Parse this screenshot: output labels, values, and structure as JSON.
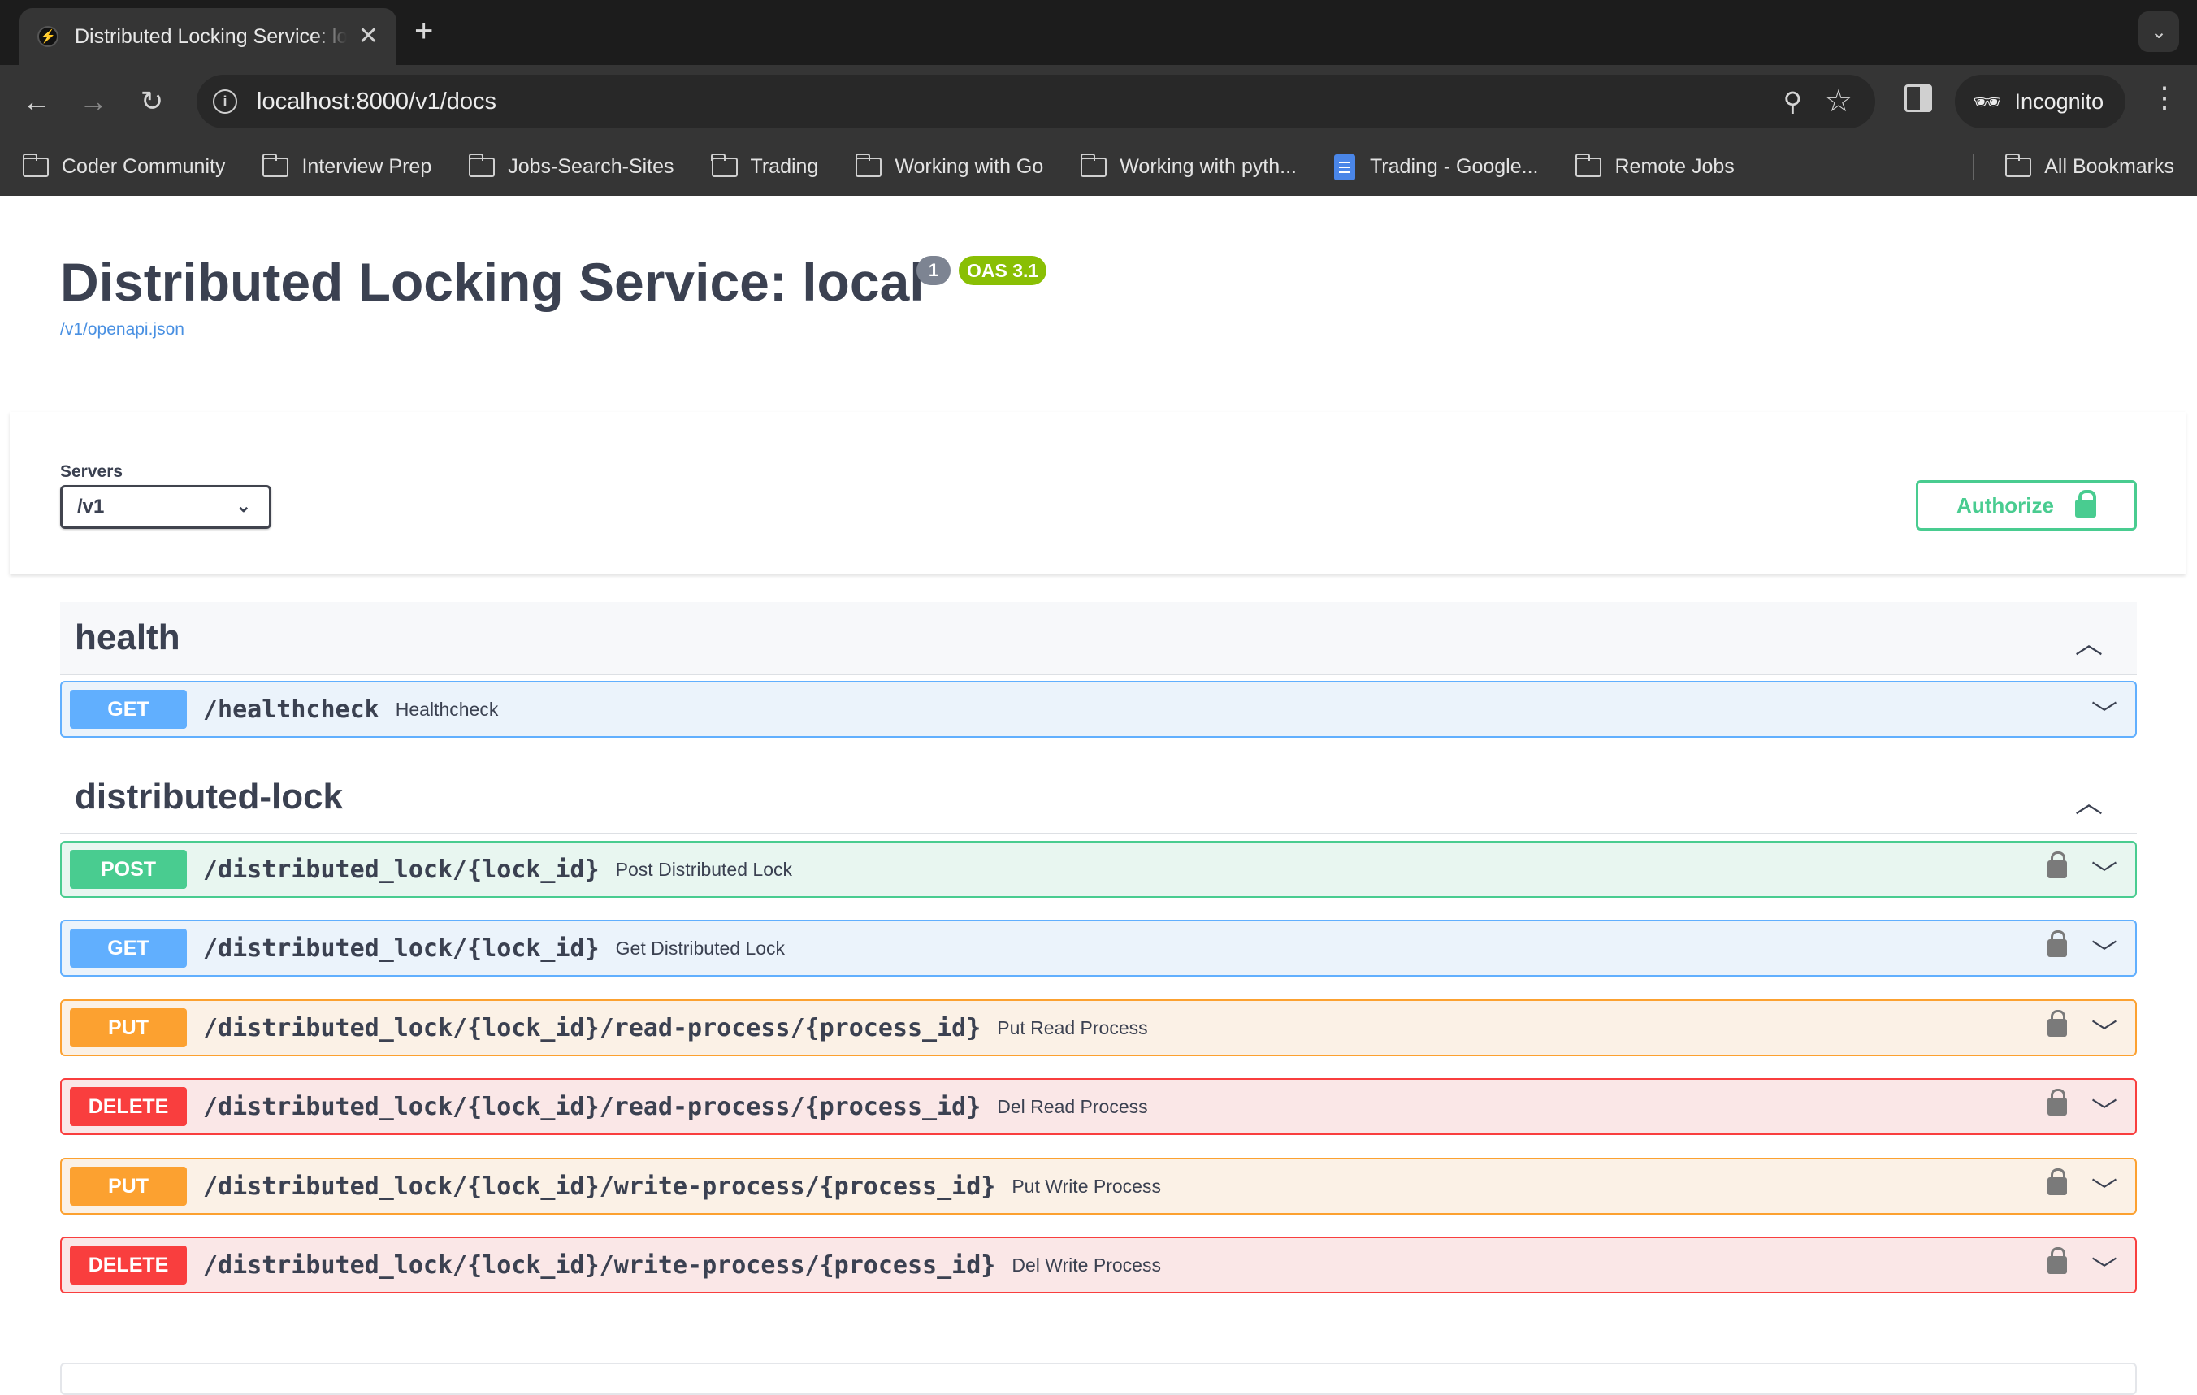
{
  "browser": {
    "tab_title": "Distributed Locking Service: local",
    "url": "localhost:8000/v1/docs",
    "profile_label": "Incognito",
    "bookmarks": [
      {
        "label": "Coder Community",
        "icon": "folder-icon"
      },
      {
        "label": "Interview Prep",
        "icon": "folder-icon"
      },
      {
        "label": "Jobs-Search-Sites",
        "icon": "folder-icon"
      },
      {
        "label": "Trading",
        "icon": "folder-icon"
      },
      {
        "label": "Working with Go",
        "icon": "folder-icon"
      },
      {
        "label": "Working with pyth...",
        "icon": "folder-icon"
      },
      {
        "label": "Trading - Google...",
        "icon": "google-docs-icon"
      },
      {
        "label": "Remote Jobs",
        "icon": "folder-icon"
      }
    ],
    "all_bookmarks_label": "All Bookmarks"
  },
  "info": {
    "title": "Distributed Locking Service: local",
    "version_badge": "1",
    "oas_badge": "OAS 3.1",
    "spec_link": "/v1/openapi.json"
  },
  "servers": {
    "label": "Servers",
    "selected": "/v1"
  },
  "authorize": {
    "label": "Authorize"
  },
  "tags": [
    {
      "name": "health",
      "operations": [
        {
          "method": "GET",
          "path": "/healthcheck",
          "summary": "Healthcheck",
          "locked": false
        }
      ]
    },
    {
      "name": "distributed-lock",
      "operations": [
        {
          "method": "POST",
          "path": "/distributed_lock/{lock_id}",
          "summary": "Post Distributed Lock",
          "locked": true
        },
        {
          "method": "GET",
          "path": "/distributed_lock/{lock_id}",
          "summary": "Get Distributed Lock",
          "locked": true
        },
        {
          "method": "PUT",
          "path": "/distributed_lock/{lock_id}/read-process/{process_id}",
          "summary": "Put Read Process",
          "locked": true
        },
        {
          "method": "DELETE",
          "path": "/distributed_lock/{lock_id}/read-process/{process_id}",
          "summary": "Del Read Process",
          "locked": true
        },
        {
          "method": "PUT",
          "path": "/distributed_lock/{lock_id}/write-process/{process_id}",
          "summary": "Put Write Process",
          "locked": true
        },
        {
          "method": "DELETE",
          "path": "/distributed_lock/{lock_id}/write-process/{process_id}",
          "summary": "Del Write Process",
          "locked": true
        }
      ]
    }
  ],
  "colors": {
    "get": "#61affe",
    "post": "#49cc90",
    "put": "#fca130",
    "delete": "#f93e3e",
    "oas_badge": "#89bf04"
  }
}
